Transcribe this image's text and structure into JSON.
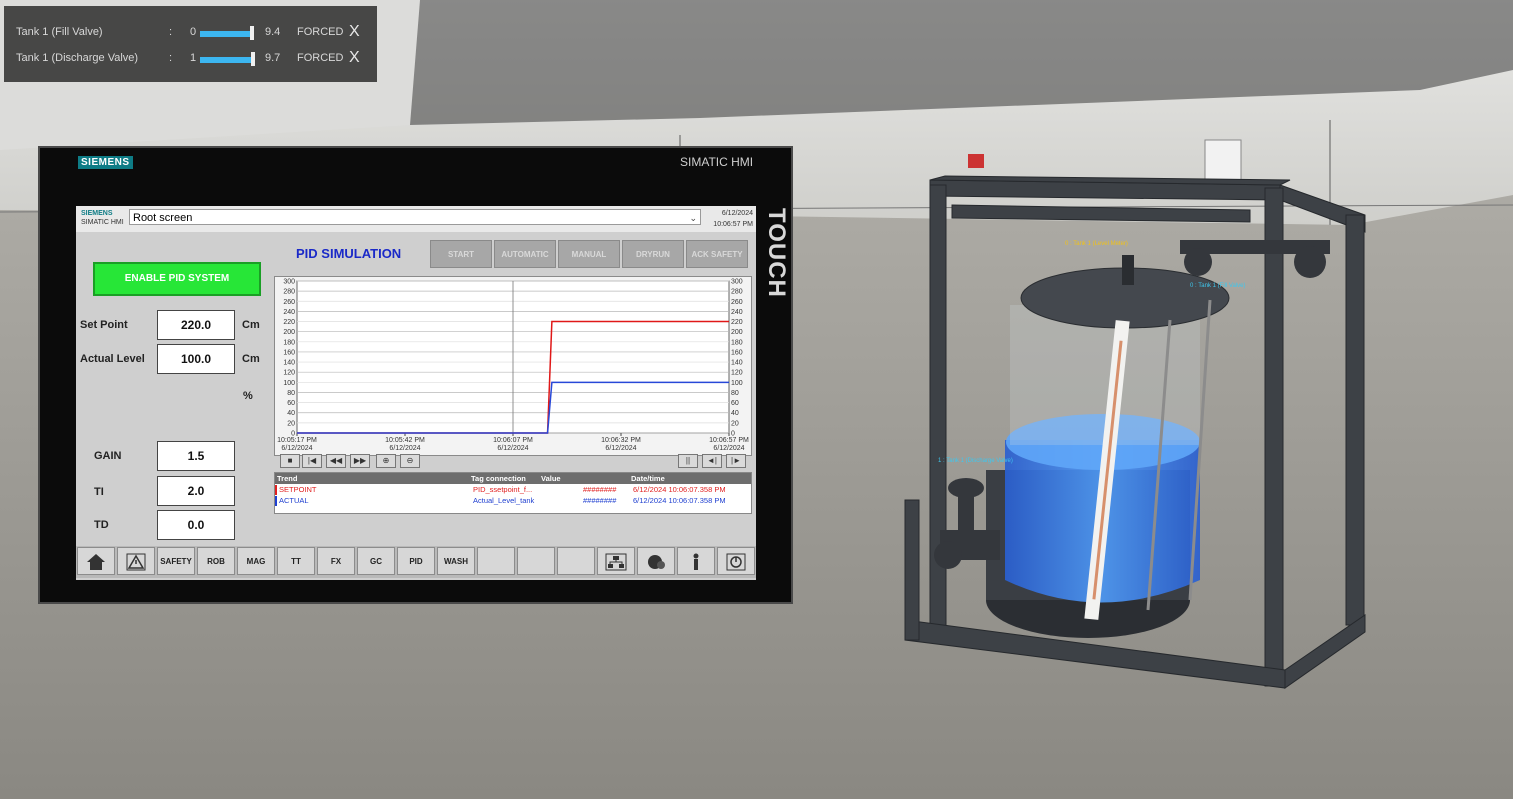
{
  "force_panel": {
    "rows": [
      {
        "name": "Tank 1 (Fill Valve)",
        "separator": ":",
        "raw": "0",
        "value": "9.4",
        "state": "FORCED",
        "close": "X"
      },
      {
        "name": "Tank 1 (Discharge Valve)",
        "separator": ":",
        "raw": "1",
        "value": "9.7",
        "state": "FORCED",
        "close": "X"
      }
    ]
  },
  "hmi": {
    "bezel_brand": "SIEMENS",
    "bezel_model": "SIMATIC HMI",
    "touch_label": "TOUCH",
    "topbar": {
      "brand": "SIEMENS",
      "brand_sub": "SIMATIC HMI",
      "screen_name": "Root screen",
      "date": "6/12/2024",
      "time": "10:06:57 PM"
    },
    "enable_button": "ENABLE PID SYSTEM",
    "title": "PID SIMULATION",
    "mode_buttons": [
      "START",
      "AUTOMATIC",
      "MANUAL",
      "DRYRUN",
      "ACK SAFETY"
    ],
    "fields": {
      "setpoint": {
        "label": "Set Point",
        "value": "220.0",
        "unit": "Cm"
      },
      "actual": {
        "label": "Actual Level",
        "value": "100.0",
        "unit": "Cm"
      },
      "percent_unit": "%",
      "gain": {
        "label": "GAIN",
        "value": "1.5"
      },
      "ti": {
        "label": "TI",
        "value": "2.0"
      },
      "td": {
        "label": "TD",
        "value": "0.0"
      }
    },
    "trend_table": {
      "headers": [
        "Trend",
        "Tag connection",
        "Value",
        "Date/time"
      ],
      "rows": [
        {
          "trend": "SETPOINT",
          "tag": "PID_ssetpoint_f...",
          "value": "########",
          "datetime": "6/12/2024 10:06:07.358 PM",
          "color": "#e02020"
        },
        {
          "trend": "ACTUAL",
          "tag": "Actual_Level_tank",
          "value": "########",
          "datetime": "6/12/2024 10:06:07.358 PM",
          "color": "#2040d0"
        }
      ]
    },
    "nav_buttons": [
      "SAFETY",
      "ROB",
      "MAG",
      "TT",
      "FX",
      "GC",
      "PID",
      "WASH"
    ]
  },
  "colors": {
    "setpoint": "#e01818",
    "actual": "#2848d8",
    "enable": "#27e637",
    "title": "#1a29c8",
    "force_slider": "#3cb6f0",
    "water": "#2f78e8"
  },
  "icons": [
    "home-icon",
    "warning-icon",
    "network-icon",
    "globe-icon",
    "user-icon",
    "power-icon"
  ],
  "scene": {
    "tag_labels": [
      "0 : Tank 1 (Level Meter)",
      "0 : Tank 1 (Fill Valve)",
      "1 : Tank 1 (Discharge Valve)"
    ]
  },
  "chart_data": {
    "type": "line",
    "title": "",
    "ylim": [
      0,
      300
    ],
    "yticks": [
      0,
      20,
      40,
      60,
      80,
      100,
      120,
      140,
      160,
      180,
      200,
      220,
      240,
      260,
      280,
      300
    ],
    "x_ticks": [
      {
        "time": "10:05:17 PM",
        "date": "6/12/2024",
        "t": 0
      },
      {
        "time": "10:05:42 PM",
        "date": "6/12/2024",
        "t": 25
      },
      {
        "time": "10:06:07 PM",
        "date": "6/12/2024",
        "t": 50
      },
      {
        "time": "10:06:32 PM",
        "date": "6/12/2024",
        "t": 75
      },
      {
        "time": "10:06:57 PM",
        "date": "6/12/2024",
        "t": 100
      }
    ],
    "series": [
      {
        "name": "SETPOINT",
        "color": "#e01818",
        "points": [
          [
            0,
            0
          ],
          [
            58,
            0
          ],
          [
            59,
            220
          ],
          [
            100,
            220
          ]
        ]
      },
      {
        "name": "ACTUAL",
        "color": "#2848d8",
        "points": [
          [
            0,
            0
          ],
          [
            58,
            0
          ],
          [
            59,
            100
          ],
          [
            100,
            100
          ]
        ]
      }
    ]
  }
}
